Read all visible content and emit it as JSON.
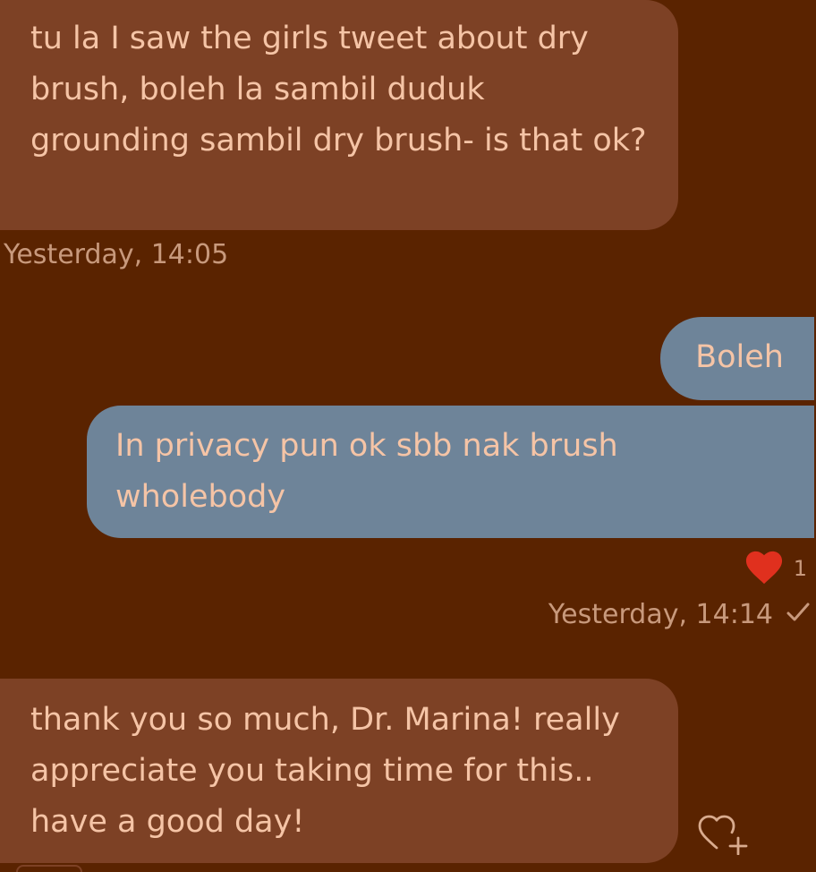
{
  "messages": [
    {
      "direction": "received",
      "text": "tu la I saw the girls tweet about dry brush, boleh la sambil duduk grounding sambil dry brush- is that ok?"
    },
    {
      "direction": "sent",
      "text": "Boleh"
    },
    {
      "direction": "sent",
      "text": "In privacy pun ok sbb nak brush wholebody"
    },
    {
      "direction": "received",
      "text": "thank you so much, Dr. Marina! really appreciate you taking time for this.. have a good day!"
    }
  ],
  "timestamps": {
    "received_1": "Yesterday, 14:05",
    "sent_group": "Yesterday, 14:14"
  },
  "reaction": {
    "icon": "heart-icon",
    "count": "1",
    "color": "#e0301e"
  },
  "status_icon": "checkmark-icon",
  "add_reaction_icon": "heart-plus-icon",
  "colors": {
    "background": "#5a2300",
    "received_bubble": "#7d4125",
    "sent_bubble": "#6e8499",
    "text": "#f5c4a6",
    "meta_text": "#c8997c"
  }
}
